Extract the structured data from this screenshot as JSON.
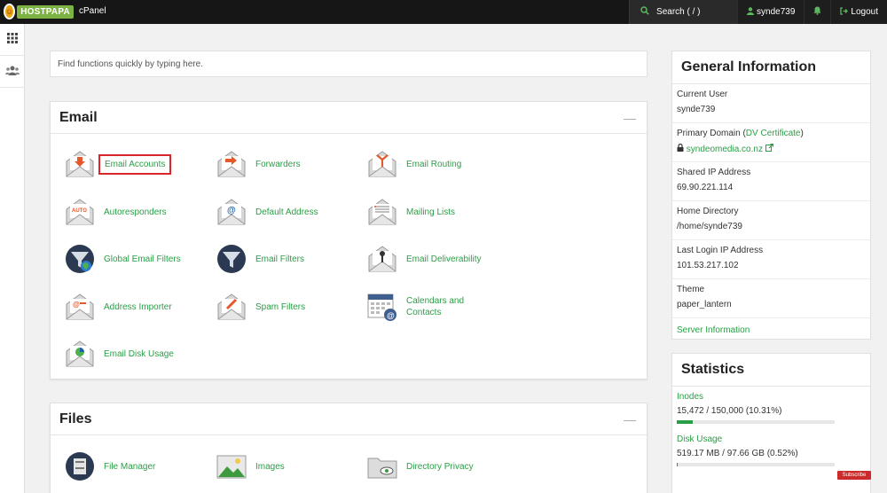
{
  "topbar": {
    "logo_text": "HOSTPAPA",
    "app_name": "cPanel",
    "search_label": "Search ( / )",
    "username": "synde739",
    "logout_label": "Logout"
  },
  "quickfind": {
    "placeholder": "Find functions quickly by typing here."
  },
  "email": {
    "title": "Email",
    "items": [
      {
        "label": "Email Accounts",
        "icon": "envelope-download-icon"
      },
      {
        "label": "Forwarders",
        "icon": "envelope-forward-icon"
      },
      {
        "label": "Email Routing",
        "icon": "envelope-routing-icon"
      },
      {
        "label": "Autoresponders",
        "icon": "envelope-auto-icon"
      },
      {
        "label": "Default Address",
        "icon": "envelope-at-icon"
      },
      {
        "label": "Mailing Lists",
        "icon": "envelope-list-icon"
      },
      {
        "label": "Global Email Filters",
        "icon": "globe-funnel-icon"
      },
      {
        "label": "Email Filters",
        "icon": "funnel-icon"
      },
      {
        "label": "Email Deliverability",
        "icon": "envelope-key-icon"
      },
      {
        "label": "Address Importer",
        "icon": "envelope-import-icon"
      },
      {
        "label": "Spam Filters",
        "icon": "envelope-spam-icon"
      },
      {
        "label": "Calendars and Contacts",
        "icon": "calendar-contacts-icon"
      },
      {
        "label": "Email Disk Usage",
        "icon": "envelope-pie-icon"
      }
    ]
  },
  "files": {
    "title": "Files",
    "items": [
      {
        "label": "File Manager",
        "icon": "file-cabinet-icon"
      },
      {
        "label": "Images",
        "icon": "image-icon"
      },
      {
        "label": "Directory Privacy",
        "icon": "folder-eye-icon"
      }
    ]
  },
  "general": {
    "title": "General Information",
    "current_user_label": "Current User",
    "current_user": "synde739",
    "primary_domain_label": "Primary Domain (",
    "dv_label": "DV Certificate",
    "primary_domain_close": ")",
    "primary_domain": "syndeomedia.co.nz",
    "shared_ip_label": "Shared IP Address",
    "shared_ip": "69.90.221.114",
    "home_dir_label": "Home Directory",
    "home_dir": "/home/synde739",
    "last_login_label": "Last Login IP Address",
    "last_login": "101.53.217.102",
    "theme_label": "Theme",
    "theme": "paper_lantern",
    "server_info": "Server Information"
  },
  "stats": {
    "title": "Statistics",
    "inodes_label": "Inodes",
    "inodes_value": "15,472 / 150,000   (10.31%)",
    "inodes_fraction": 0.1031,
    "disk_label": "Disk Usage",
    "disk_value": "519.17 MB / 97.66 GB   (0.52%)",
    "disk_fraction": 0.0052
  },
  "overlay": {
    "subscribe": "Subscribe"
  },
  "colors": {
    "accent": "#2a9e46",
    "highlight": "#d9262c",
    "topbar": "#161616"
  }
}
